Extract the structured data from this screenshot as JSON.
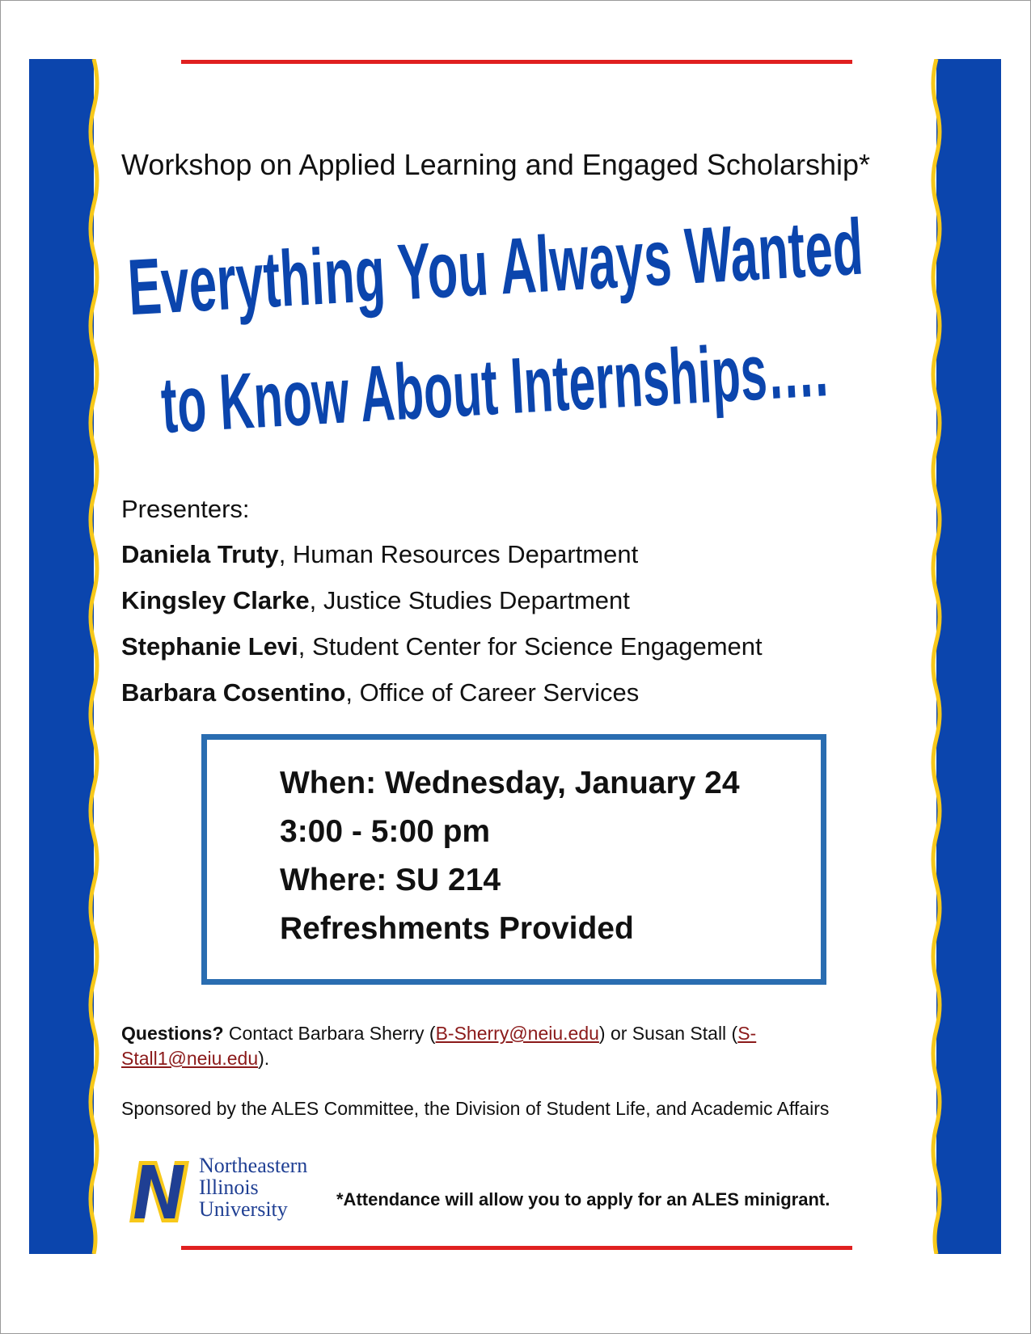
{
  "colors": {
    "band_blue": "#0b45ad",
    "band_yellow": "#f7c81a",
    "rule_red": "#e02020",
    "headline_blue": "#0b45ad",
    "box_border": "#2a6db1",
    "link": "#8b1a1a",
    "logo_blue": "#1f3f93"
  },
  "header": {
    "subtitle": "Workshop on Applied Learning and Engaged Scholarship*",
    "headline_line1": "Everything You Always Wanted",
    "headline_line2": "to Know About Internships…."
  },
  "presenters": {
    "heading": "Presenters:",
    "items": [
      {
        "name": "Daniela Truty",
        "affiliation": ", Human Resources Department"
      },
      {
        "name": "Kingsley Clarke",
        "affiliation": ", Justice Studies Department"
      },
      {
        "name": "Stephanie Levi",
        "affiliation": ", Student Center for Science Engagement"
      },
      {
        "name": "Barbara Cosentino",
        "affiliation": ", Office of Career Services"
      }
    ]
  },
  "event": {
    "when": "When: Wednesday, January 24",
    "time": "3:00 - 5:00 pm",
    "where": "Where: SU 214",
    "refreshments": "Refreshments Provided"
  },
  "contact": {
    "label": "Questions?",
    "text_before": " Contact Barbara Sherry (",
    "email1": "B-Sherry@neiu.edu",
    "text_middle": ") or Susan Stall (",
    "email2": "S-Stall1@neiu.edu",
    "text_after": ")."
  },
  "sponsor": "Sponsored by the ALES Committee, the Division of Student Life, and Academic Affairs",
  "logo": {
    "mark_icon": "neiu-n-logo-icon",
    "line1": "Northeastern",
    "line2": "Illinois",
    "line3": "University"
  },
  "footnote": "*Attendance will allow you to apply for an ALES minigrant."
}
